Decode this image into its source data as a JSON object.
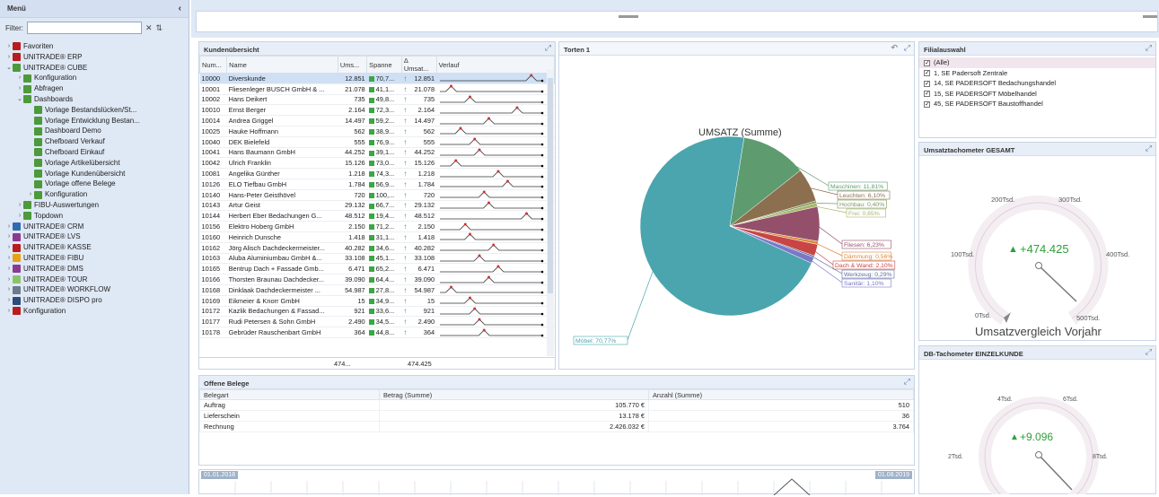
{
  "sidebar": {
    "title": "Menü",
    "filter_label": "Filter:",
    "items": [
      {
        "label": "Favoriten",
        "level": 0,
        "arr": ">",
        "icon": "red"
      },
      {
        "label": "UNITRADE® ERP",
        "level": 0,
        "arr": ">",
        "icon": "red"
      },
      {
        "label": "UNITRADE® CUBE",
        "level": 0,
        "arr": "v",
        "icon": "grn"
      },
      {
        "label": "Konfiguration",
        "level": 1,
        "arr": ">",
        "icon": "grn"
      },
      {
        "label": "Abfragen",
        "level": 1,
        "arr": ">",
        "icon": "grn"
      },
      {
        "label": "Dashboards",
        "level": 1,
        "arr": "v",
        "icon": "grn"
      },
      {
        "label": "Vorlage Bestandslücken/St...",
        "level": 2,
        "arr": "",
        "icon": "grn"
      },
      {
        "label": "Vorlage Entwicklung Bestan...",
        "level": 2,
        "arr": "",
        "icon": "grn"
      },
      {
        "label": "Dashboard Demo",
        "level": 2,
        "arr": "",
        "icon": "grn"
      },
      {
        "label": "Chefboard Verkauf",
        "level": 2,
        "arr": "",
        "icon": "grn"
      },
      {
        "label": "Chefboard Einkauf",
        "level": 2,
        "arr": "",
        "icon": "grn"
      },
      {
        "label": "Vorlage Artikelübersicht",
        "level": 2,
        "arr": "",
        "icon": "grn"
      },
      {
        "label": "Vorlage Kundenübersicht",
        "level": 2,
        "arr": "",
        "icon": "grn"
      },
      {
        "label": "Vorlage offene Belege",
        "level": 2,
        "arr": "",
        "icon": "grn"
      },
      {
        "label": "Konfiguration",
        "level": 2,
        "arr": ">",
        "icon": "grn"
      },
      {
        "label": "FIBU-Auswertungen",
        "level": 1,
        "arr": ">",
        "icon": "grn"
      },
      {
        "label": "Topdown",
        "level": 1,
        "arr": ">",
        "icon": "grn"
      },
      {
        "label": "UNITRADE® CRM",
        "level": 0,
        "arr": ">",
        "icon": "blu"
      },
      {
        "label": "UNITRADE® LVS",
        "level": 0,
        "arr": ">",
        "icon": "pur"
      },
      {
        "label": "UNITRADE® KASSE",
        "level": 0,
        "arr": ">",
        "icon": "red"
      },
      {
        "label": "UNITRADE® FIBU",
        "level": 0,
        "arr": ">",
        "icon": "org"
      },
      {
        "label": "UNITRADE® DMS",
        "level": 0,
        "arr": ">",
        "icon": "pur"
      },
      {
        "label": "UNITRADE® TOUR",
        "level": 0,
        "arr": ">",
        "icon": "ltg"
      },
      {
        "label": "UNITRADE® WORKFLOW",
        "level": 0,
        "arr": ">",
        "icon": "gry"
      },
      {
        "label": "UNITRADE® DISPO pro",
        "level": 0,
        "arr": ">",
        "icon": "navy"
      },
      {
        "label": "Konfiguration",
        "level": 0,
        "arr": ">",
        "icon": "red"
      }
    ]
  },
  "kunden": {
    "title": "Kundenübersicht",
    "columns": [
      "Num...",
      "Name",
      "Ums...",
      "Spanne",
      "Δ Umsat...",
      "Verlauf"
    ],
    "rows": [
      [
        "10000",
        "Diverskunde",
        "12.851",
        "70,7...",
        "12.851"
      ],
      [
        "10001",
        "Fliesenleger BUSCH GmbH & ...",
        "21.078",
        "41,1...",
        "21.078"
      ],
      [
        "10002",
        "Hans Deikert",
        "735",
        "49,8...",
        "735"
      ],
      [
        "10010",
        "Ernst Berger",
        "2.164",
        "72,3...",
        "2.164"
      ],
      [
        "10014",
        "Andrea Griggel",
        "14.497",
        "59,2...",
        "14.497"
      ],
      [
        "10025",
        "Hauke Hoffmann",
        "562",
        "38,9...",
        "562"
      ],
      [
        "10040",
        "DEK Bielefeld",
        "555",
        "76,9...",
        "555"
      ],
      [
        "10041",
        "Hans Baumann GmbH",
        "44.252",
        "39,1...",
        "44.252"
      ],
      [
        "10042",
        "Ulrich Franklin",
        "15.126",
        "73,0...",
        "15.126"
      ],
      [
        "10081",
        "Angelika Günther",
        "1.218",
        "74,3...",
        "1.218"
      ],
      [
        "10126",
        "ELO Tiefbau GmbH",
        "1.784",
        "56,9...",
        "1.784"
      ],
      [
        "10140",
        "Hans-Peter Geisthövel",
        "720",
        "100,...",
        "720"
      ],
      [
        "10143",
        "Artur Geist",
        "29.132",
        "66,7...",
        "29.132"
      ],
      [
        "10144",
        "Herbert Eber Bedachungen G...",
        "48.512",
        "19,4...",
        "48.512"
      ],
      [
        "10156",
        "Elektro Hoberg GmbH",
        "2.150",
        "71,2...",
        "2.150"
      ],
      [
        "10160",
        "Heinrich Dunsche",
        "1.418",
        "31,1...",
        "1.418"
      ],
      [
        "10162",
        "Jörg Alisch Dachdeckermeister...",
        "40.282",
        "34,6...",
        "40.282"
      ],
      [
        "10163",
        "Aluba Aluminiumbau GmbH &...",
        "33.108",
        "45,1...",
        "33.108"
      ],
      [
        "10165",
        "Bentrup Dach + Fassade Gmb...",
        "6.471",
        "65,2...",
        "6.471"
      ],
      [
        "10166",
        "Thorsten Braunau Dachdecker...",
        "39.090",
        "64,4...",
        "39.090"
      ],
      [
        "10168",
        "Dinklaak Dachdeckermeister ...",
        "54.987",
        "27,8...",
        "54.987"
      ],
      [
        "10169",
        "Eikmeier & Knorr GmbH",
        "15",
        "34,9...",
        "15"
      ],
      [
        "10172",
        "Kazlik Bedachungen & Fassad...",
        "921",
        "33,6...",
        "921"
      ],
      [
        "10177",
        "Rudi Petersen & Sohn GmbH",
        "2.490",
        "34,5...",
        "2.490"
      ],
      [
        "10178",
        "Gebrüder Rauschenbart GmbH",
        "364",
        "44,8...",
        "364"
      ]
    ],
    "total1": "474...",
    "total2": "474.425"
  },
  "torten": {
    "title": "Torten 1",
    "chart_title": "UMSATZ (Summe)"
  },
  "chart_data": {
    "type": "pie",
    "title": "UMSATZ (Summe)",
    "slices": [
      {
        "label": "Möbel: 70,77%",
        "value": 70.77,
        "color": "#4aa5ae"
      },
      {
        "label": "Maschinen: 11,81%",
        "value": 11.81,
        "color": "#5e9b6f"
      },
      {
        "label": "Leuchten: 6,10%",
        "value": 6.1,
        "color": "#8c6f4e"
      },
      {
        "label": "Hochbau: 0,40%",
        "value": 0.4,
        "color": "#7a9a5e"
      },
      {
        "label": "Frei: 0,65%",
        "value": 0.65,
        "color": "#a8b56a"
      },
      {
        "label": "Fliesen: 6,23%",
        "value": 6.23,
        "color": "#94506a"
      },
      {
        "label": "Dämmung: 0,56%",
        "value": 0.56,
        "color": "#d98b3a"
      },
      {
        "label": "Dach & Wand: 2,10%",
        "value": 2.1,
        "color": "#c94545"
      },
      {
        "label": "Werkzeug: 0,29%",
        "value": 0.29,
        "color": "#5a6f9c"
      },
      {
        "label": "Sanitär: 1,10%",
        "value": 1.1,
        "color": "#7a78c8"
      }
    ]
  },
  "filial": {
    "title": "Filialauswahl",
    "items": [
      "(Alle)",
      "1, SE Padersoft Zentrale",
      "14, SE PADERSOFT Bedachungshandel",
      "15, SE PADERSOFT Möbelhandel",
      "45, SE PADERSOFT Baustoffhandel"
    ]
  },
  "gauge1": {
    "title": "Umsatztachometer GESAMT",
    "value": "+474.425",
    "ticks": [
      "0Tsd.",
      "100Tsd.",
      "200Tsd.",
      "300Tsd.",
      "400Tsd.",
      "500Tsd."
    ],
    "caption": "Umsatzvergleich  Vorjahr"
  },
  "gauge2": {
    "title": "DB-Tachometer EINZELKUNDE",
    "value": "+9.096",
    "ticks": [
      "2Tsd.",
      "4Tsd.",
      "6Tsd.",
      "8Tsd."
    ]
  },
  "offene": {
    "title": "Offene Belege",
    "columns": [
      "Belegart",
      "Betrag (Summe)",
      "Anzahl (Summe)"
    ],
    "rows": [
      [
        "Auftrag",
        "105.770 €",
        "510"
      ],
      [
        "Lieferschein",
        "13.178 €",
        "36"
      ],
      [
        "Rechnung",
        "2.426.032 €",
        "3.764"
      ]
    ]
  },
  "timeline": {
    "start": "01.01.2018",
    "end": "01.08.2019"
  }
}
